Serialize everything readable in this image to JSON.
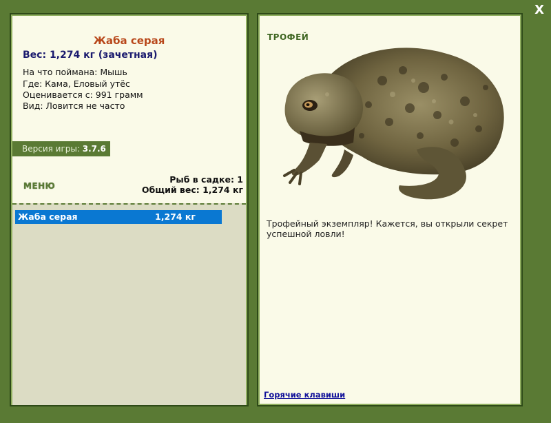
{
  "window": {
    "close_label": "X"
  },
  "fish": {
    "name": "Жаба серая",
    "weight_line": "Вес: 1,274 кг (зачетная)",
    "info": [
      "На что поймана: Мышь",
      "Где: Кама, Еловый утёс",
      "Оценивается с: 991 грамм",
      "Вид: Ловится не часто"
    ]
  },
  "version": {
    "label": "Версия игры:",
    "value": "3.7.6"
  },
  "menu": {
    "label": "МЕНЮ"
  },
  "keep": {
    "count_line": "Рыб в садке: 1",
    "total_line": "Общий вес: 1,274 кг"
  },
  "catch_list": [
    {
      "name": "Жаба серая",
      "weight": "1,274 кг"
    }
  ],
  "trophy": {
    "label": "ТРОФЕЙ",
    "message": "Трофейный экземпляр! Кажется, вы открыли секрет успешной ловли!",
    "image_subject": "toad"
  },
  "footer": {
    "hotkeys_link": "Горячие клавиши"
  },
  "colors": {
    "frame_green": "#5a7a34",
    "panel_bg": "#fafae8",
    "title_orange": "#b8471a",
    "weight_blue": "#1a1a6e",
    "selection_blue": "#0a78d2"
  }
}
